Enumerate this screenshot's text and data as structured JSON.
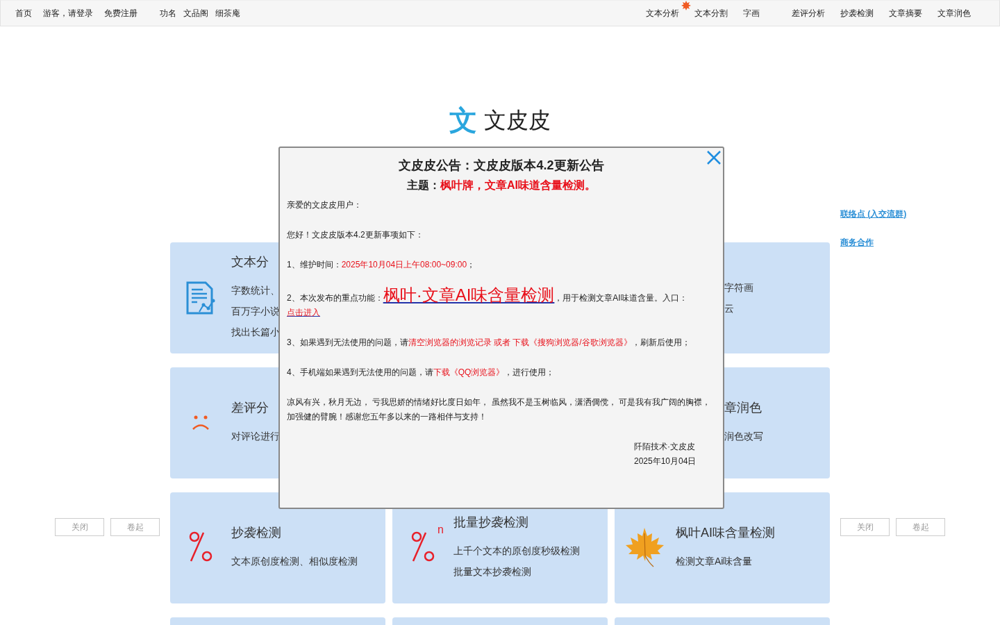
{
  "nav": {
    "left_groups": [
      [
        "首页",
        "游客，请登录",
        "免费注册"
      ],
      [
        "功名",
        "文品阁",
        "细茶庵"
      ]
    ],
    "right": [
      {
        "label": "文本分析",
        "new_badge": true
      },
      {
        "label": "文本分割",
        "new_badge": false
      },
      {
        "label": "字画",
        "new_badge": false
      },
      {
        "label": "差评分析",
        "new_badge": false
      },
      {
        "label": "抄袭检测",
        "new_badge": false
      },
      {
        "label": "文章摘要",
        "new_badge": false
      },
      {
        "label": "文章润色",
        "new_badge": false
      }
    ]
  },
  "logo": {
    "mark": "文",
    "name": "文皮皮"
  },
  "side_links": [
    "联络点 (入交流群)",
    "商务合作"
  ],
  "side_buttons": {
    "left": [
      "关闭",
      "卷起"
    ],
    "right": [
      "关闭",
      "卷起"
    ]
  },
  "rows": [
    {
      "left": {
        "kind": "doc-chart",
        "title": "文本分",
        "lines": [
          "字数统计、",
          "百万字小说",
          "找出长篇小"
        ]
      },
      "right": {
        "kind": "covered",
        "lines": [
          "字符画",
          "云"
        ]
      }
    },
    {
      "left": {
        "kind": "sad",
        "title": "差评分",
        "lines": [
          "对评论进行"
        ]
      },
      "right": {
        "kind": "covered",
        "title": "章润色",
        "lines": [
          "润色改写"
        ]
      }
    },
    {
      "left": {
        "kind": "percent",
        "title": "抄袭检测",
        "lines": [
          "文本原创度检测、相似度检测"
        ]
      },
      "middle": {
        "kind": "percent",
        "icon_text": "n",
        "title": "批量抄袭检测",
        "lines": [
          "上千个文本的原创度秒级检测",
          "批量文本抄袭检测"
        ]
      },
      "right": {
        "kind": "leaf",
        "title": "枫叶AI味含量检测",
        "lines": [
          "检测文章Ai味含量"
        ]
      }
    },
    {
      "left": {
        "kind": "blank"
      },
      "middle": {
        "kind": "blank"
      },
      "right": {
        "kind": "blank"
      }
    }
  ],
  "notice": {
    "title": "文皮皮公告：文皮皮版本4.2更新公告",
    "subject_label": "主题：",
    "subject": "枫叶牌，文章AI味道含量检测。",
    "paragraphs": [
      [
        {
          "kind": "plain",
          "text": "亲爱的文皮皮用户："
        }
      ],
      [
        {
          "kind": "plain",
          "text": "您好！文皮皮版本4.2更新事项如下："
        }
      ],
      [
        {
          "kind": "plain",
          "text": "1、维护时间："
        },
        {
          "kind": "red",
          "text": "2025年10月04日上午08:00~09:00"
        },
        {
          "kind": "plain",
          "text": "；"
        }
      ],
      [
        {
          "kind": "plain",
          "text": "2、本次发布的重点功能："
        },
        {
          "kind": "big-link",
          "text": "枫叶·文章AI味含量检测"
        },
        {
          "kind": "plain",
          "text": "，用于检测文章AI味道含量。入口："
        },
        {
          "kind": "link",
          "text": "点击进入"
        }
      ],
      [
        {
          "kind": "plain",
          "text": "3、如果遇到无法使用的问题，请"
        },
        {
          "kind": "red",
          "text": "清空浏览器的浏览记录 或者 下载《搜狗浏览器/谷歌浏览器》"
        },
        {
          "kind": "plain",
          "text": "，刷新后使用；"
        }
      ],
      [
        {
          "kind": "plain",
          "text": "4、手机端如果遇到无法使用的问题，请"
        },
        {
          "kind": "red",
          "text": "下载《QQ浏览器》"
        },
        {
          "kind": "plain",
          "text": "，进行使用；"
        }
      ],
      [
        {
          "kind": "plain",
          "text": "凉风有兴，秋月无边， 亏我思娇的情绪好比度日如年， 虽然我不是玉树临风，潇洒倜傥， 可是我有我广阔的胸襟，加强健的臂腕！感谢您五年多以来的一路相伴与支持！"
        }
      ]
    ],
    "signature": [
      "阡陌技术·文皮皮",
      "2025年10月04日"
    ]
  }
}
